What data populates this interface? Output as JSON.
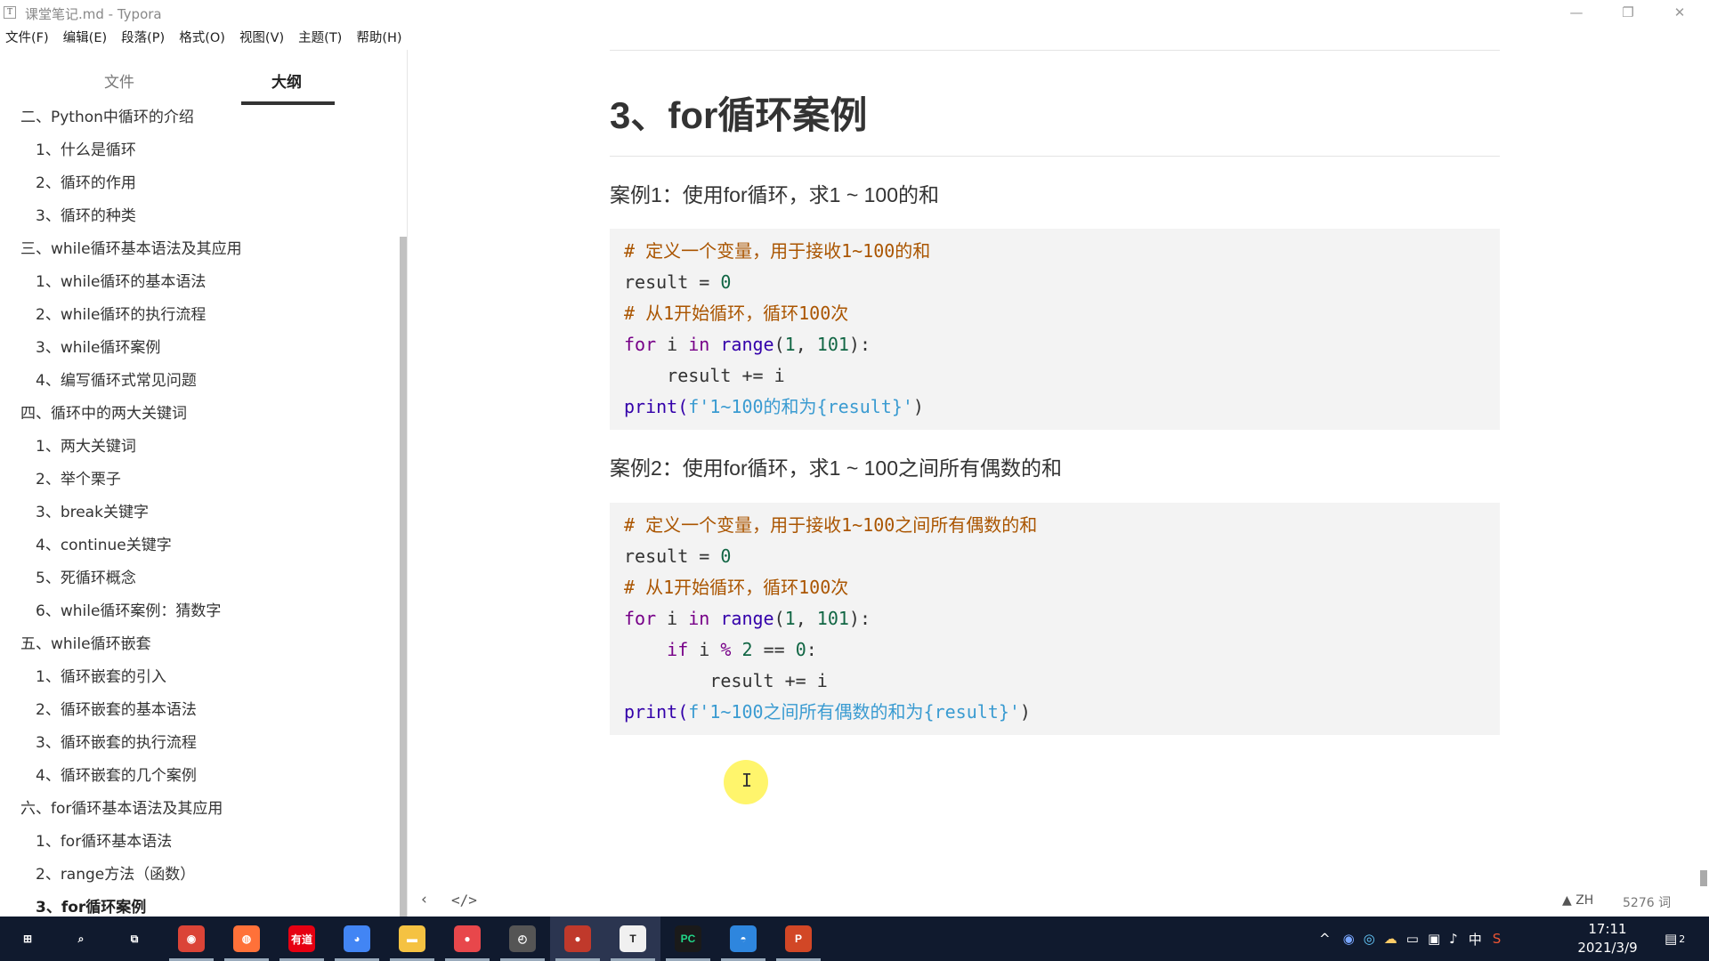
{
  "window": {
    "app_icon": "T",
    "title": "课堂笔记.md - Typora",
    "minimize": "—",
    "restore": "❐",
    "close": "✕"
  },
  "menu": [
    "文件(F)",
    "编辑(E)",
    "段落(P)",
    "格式(O)",
    "视图(V)",
    "主题(T)",
    "帮助(H)"
  ],
  "sidebar": {
    "tab_file": "文件",
    "tab_outline": "大纲",
    "outline": [
      {
        "level": 1,
        "label": "二、Python中循环的介绍"
      },
      {
        "level": 2,
        "label": "1、什么是循环"
      },
      {
        "level": 2,
        "label": "2、循环的作用"
      },
      {
        "level": 2,
        "label": "3、循环的种类"
      },
      {
        "level": 1,
        "label": "三、while循环基本语法及其应用"
      },
      {
        "level": 2,
        "label": "1、while循环的基本语法"
      },
      {
        "level": 2,
        "label": "2、while循环的执行流程"
      },
      {
        "level": 2,
        "label": "3、while循环案例"
      },
      {
        "level": 2,
        "label": "4、编写循环式常见问题"
      },
      {
        "level": 1,
        "label": "四、循环中的两大关键词"
      },
      {
        "level": 2,
        "label": "1、两大关键词"
      },
      {
        "level": 2,
        "label": "2、举个栗子"
      },
      {
        "level": 2,
        "label": "3、break关键字"
      },
      {
        "level": 2,
        "label": "4、continue关键字"
      },
      {
        "level": 2,
        "label": "5、死循环概念"
      },
      {
        "level": 2,
        "label": "6、while循环案例：猜数字"
      },
      {
        "level": 1,
        "label": "五、while循环嵌套"
      },
      {
        "level": 2,
        "label": "1、循环嵌套的引入"
      },
      {
        "level": 2,
        "label": "2、循环嵌套的基本语法"
      },
      {
        "level": 2,
        "label": "3、循环嵌套的执行流程"
      },
      {
        "level": 2,
        "label": "4、循环嵌套的几个案例"
      },
      {
        "level": 1,
        "label": "六、for循环基本语法及其应用"
      },
      {
        "level": 2,
        "label": "1、for循环基本语法"
      },
      {
        "level": 2,
        "label": "2、range方法（函数）"
      },
      {
        "level": 2,
        "label": "3、for循环案例",
        "active": true
      }
    ]
  },
  "doc": {
    "heading": "3、for循环案例",
    "case1_title": "案例1：使用for循环，求1 ~ 100的和",
    "case2_title": "案例2：使用for循环，求1 ~ 100之间所有偶数的和",
    "code1": [
      [
        {
          "t": "# 定义一个变量，用于接收1~100的和",
          "c": "tk-c"
        }
      ],
      [
        {
          "t": "result = "
        },
        {
          "t": "0",
          "c": "tk-n"
        }
      ],
      [
        {
          "t": "# 从1开始循环，循环100次",
          "c": "tk-c"
        }
      ],
      [
        {
          "t": "for",
          "c": "tk-k"
        },
        {
          "t": " i "
        },
        {
          "t": "in",
          "c": "tk-k"
        },
        {
          "t": " "
        },
        {
          "t": "range",
          "c": "tk-b"
        },
        {
          "t": "("
        },
        {
          "t": "1",
          "c": "tk-n"
        },
        {
          "t": ", "
        },
        {
          "t": "101",
          "c": "tk-n"
        },
        {
          "t": "):"
        }
      ],
      [
        {
          "t": "    result += i"
        }
      ],
      [
        {
          "t": "print",
          "c": "tk-b"
        },
        {
          "t": "(",
          "c": "tk-b"
        },
        {
          "t": "f'1~100的和为{result}'",
          "c": "tk-st"
        },
        {
          "t": ")"
        }
      ]
    ],
    "code2": [
      [
        {
          "t": "# 定义一个变量，用于接收1~100之间所有偶数的和",
          "c": "tk-c"
        }
      ],
      [
        {
          "t": "result = "
        },
        {
          "t": "0",
          "c": "tk-n"
        }
      ],
      [
        {
          "t": "# 从1开始循环，循环100次",
          "c": "tk-c"
        }
      ],
      [
        {
          "t": "for",
          "c": "tk-k"
        },
        {
          "t": " i "
        },
        {
          "t": "in",
          "c": "tk-k"
        },
        {
          "t": " "
        },
        {
          "t": "range",
          "c": "tk-b"
        },
        {
          "t": "("
        },
        {
          "t": "1",
          "c": "tk-n"
        },
        {
          "t": ", "
        },
        {
          "t": "101",
          "c": "tk-n"
        },
        {
          "t": "):"
        }
      ],
      [
        {
          "t": "    "
        },
        {
          "t": "if",
          "c": "tk-k"
        },
        {
          "t": " i "
        },
        {
          "t": "%",
          "c": "tk-k"
        },
        {
          "t": " "
        },
        {
          "t": "2",
          "c": "tk-n"
        },
        {
          "t": " == "
        },
        {
          "t": "0",
          "c": "tk-n"
        },
        {
          "t": ":"
        }
      ],
      [
        {
          "t": "        result += i"
        }
      ],
      [
        {
          "t": "print",
          "c": "tk-b"
        },
        {
          "t": "(",
          "c": "tk-b"
        },
        {
          "t": "f'1~100之间所有偶数的和为{result}'",
          "c": "tk-st"
        },
        {
          "t": ")"
        }
      ]
    ]
  },
  "statusbar": {
    "back": "‹",
    "source": "</>",
    "lang": "▲ ZH",
    "words": "5276 词"
  },
  "taskbar": {
    "clock_time": "17:11",
    "clock_date": "2021/3/9",
    "ime": "中",
    "notif_count": "2",
    "apps": [
      {
        "name": "windows-start-icon",
        "glyph": "⊞",
        "bg": ""
      },
      {
        "name": "search-icon",
        "glyph": "⌕",
        "bg": ""
      },
      {
        "name": "task-view-icon",
        "glyph": "⧉",
        "bg": ""
      },
      {
        "name": "chrome-icon",
        "glyph": "◉",
        "bg": "#db4437"
      },
      {
        "name": "firefox-icon",
        "glyph": "◍",
        "bg": "#ff7139"
      },
      {
        "name": "youdao-icon",
        "glyph": "有道",
        "bg": "#e60012"
      },
      {
        "name": "browser-icon",
        "glyph": "◕",
        "bg": "#4285f4"
      },
      {
        "name": "file-explorer-icon",
        "glyph": "▬",
        "bg": "#f5c242"
      },
      {
        "name": "screen-recorder-icon",
        "glyph": "●",
        "bg": "#e8474b"
      },
      {
        "name": "clock-app-icon",
        "glyph": "◴",
        "bg": "#555"
      },
      {
        "name": "record-icon",
        "glyph": "●",
        "bg": "#c0392b"
      },
      {
        "name": "typora-icon",
        "glyph": "T",
        "bg": "#f0f0f0"
      },
      {
        "name": "pycharm-icon",
        "glyph": "PC",
        "bg": "#1a1a1a"
      },
      {
        "name": "chat-app-icon",
        "glyph": "◓",
        "bg": "#2e86de"
      },
      {
        "name": "powerpoint-icon",
        "glyph": "P",
        "bg": "#d24726"
      }
    ]
  }
}
